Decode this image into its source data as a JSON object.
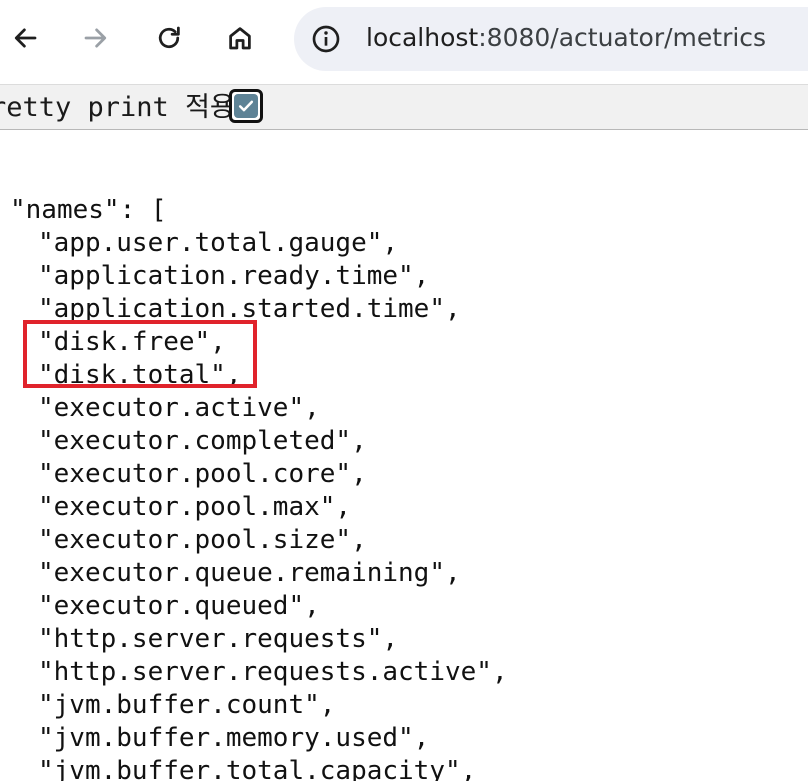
{
  "browser": {
    "back_icon": "arrow-left-icon",
    "forward_icon": "arrow-right-icon",
    "reload_icon": "reload-icon",
    "home_icon": "home-icon",
    "site_info_icon": "info-icon",
    "url_host": "localhost",
    "url_rest": ":8080/actuator/metrics"
  },
  "pretty_print": {
    "label": "retty print 적용",
    "checked": true,
    "check_color": "#5e8396"
  },
  "json_view": {
    "key_line": "\"names\": [",
    "names": [
      "\"app.user.total.gauge\",",
      "\"application.ready.time\",",
      "\"application.started.time\",",
      "\"disk.free\",",
      "\"disk.total\",",
      "\"executor.active\",",
      "\"executor.completed\",",
      "\"executor.pool.core\",",
      "\"executor.pool.max\",",
      "\"executor.pool.size\",",
      "\"executor.queue.remaining\",",
      "\"executor.queued\",",
      "\"http.server.requests\",",
      "\"http.server.requests.active\",",
      "\"jvm.buffer.count\",",
      "\"jvm.buffer.memory.used\",",
      "\"jvm.buffer.total.capacity\","
    ],
    "highlight_color": "#e0232b"
  }
}
